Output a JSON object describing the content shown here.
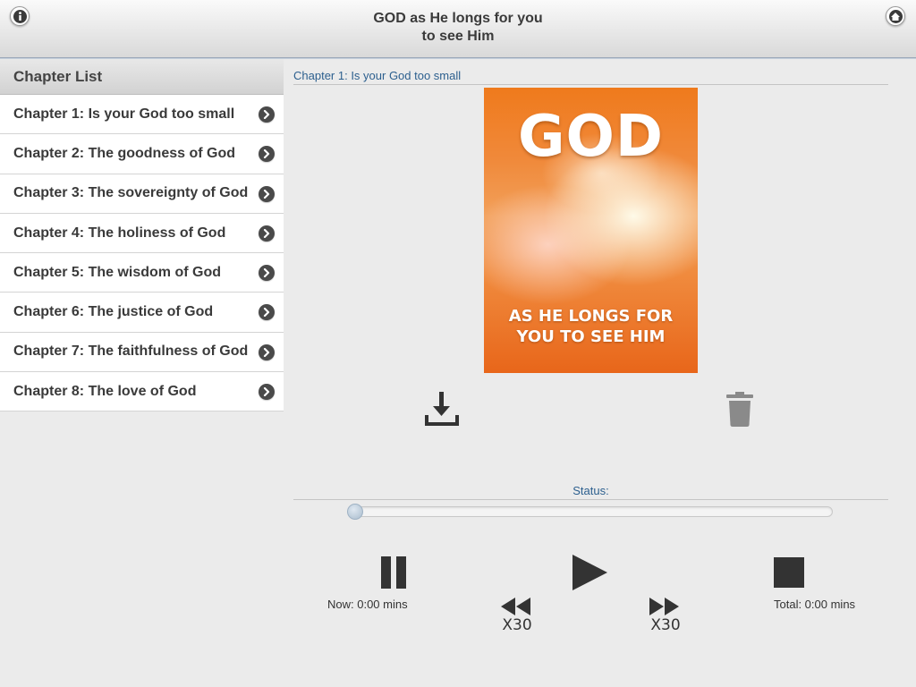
{
  "header": {
    "title_line1": "GOD as He longs for you",
    "title_line2": "to see Him",
    "info_icon": "info-icon",
    "home_icon": "home-icon"
  },
  "sidebar": {
    "title": "Chapter List",
    "chapters": [
      {
        "label": "Chapter 1: Is your God too small"
      },
      {
        "label": "Chapter 2: The goodness of God"
      },
      {
        "label": "Chapter 3: The sovereignty of God"
      },
      {
        "label": "Chapter 4: The holiness of God"
      },
      {
        "label": "Chapter 5: The wisdom of God"
      },
      {
        "label": "Chapter 6: The justice of God"
      },
      {
        "label": "Chapter 7: The faithfulness of God"
      },
      {
        "label": "Chapter 8: The love of God"
      }
    ]
  },
  "main": {
    "current_chapter": "Chapter 1: Is your God too small",
    "cover": {
      "big_text": "GOD",
      "subtitle_line1": "AS HE LONGS FOR",
      "subtitle_line2": "YOU TO SEE HIM"
    },
    "status_label": "Status:",
    "progress": 0
  },
  "player": {
    "now_label": "Now: 0:00 mins",
    "total_label": "Total: 0:00 mins",
    "rewind_label": "X30",
    "forward_label": "X30"
  },
  "colors": {
    "accent_text": "#2c5f8e",
    "icon_dark": "#333333",
    "trash_gray": "#8a8a8a"
  }
}
